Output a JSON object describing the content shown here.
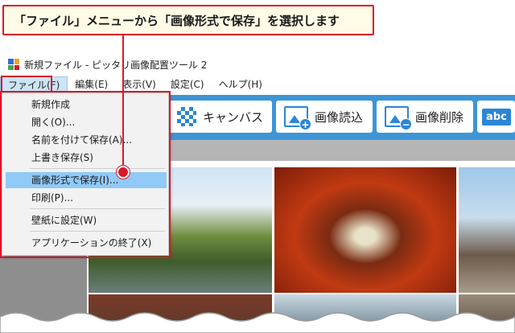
{
  "callout": {
    "text": "「ファイル」メニューから「画像形式で保存」を選択します"
  },
  "window": {
    "title": "新規ファイル - ピッタリ画像配置ツール 2"
  },
  "menubar": {
    "items": [
      "ファイル(F)",
      "編集(E)",
      "表示(V)",
      "設定(C)",
      "ヘルプ(H)"
    ]
  },
  "toolbar": {
    "canvas_label": "キャンバス",
    "load_label": "画像読込",
    "delete_label": "画像削除",
    "text_label": "abc",
    "load_badge": "+",
    "delete_badge": "−"
  },
  "file_menu": {
    "items": [
      "新規作成",
      "開く(O)...",
      "名前を付けて保存(A)...",
      "上書き保存(S)",
      "画像形式で保存(I)...",
      "印刷(P)...",
      "壁紙に設定(W)",
      "アプリケーションの終了(X)"
    ],
    "selected_index": 4
  },
  "colors": {
    "accent_red": "#d8192a",
    "toolbar_blue": "#3d95d6",
    "selection_blue": "#91c9f7"
  },
  "icons": [
    "app-icon",
    "canvas-icon",
    "image-load-icon",
    "image-delete-icon",
    "text-icon"
  ]
}
